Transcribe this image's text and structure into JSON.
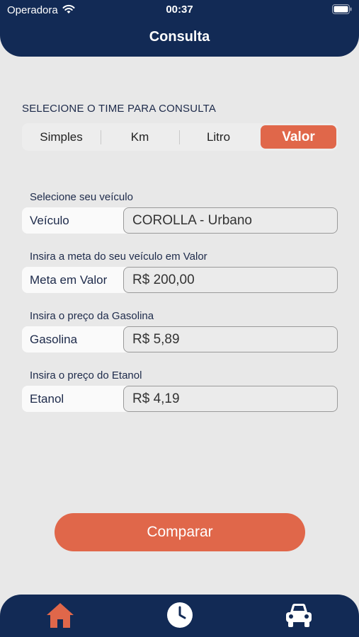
{
  "status_bar": {
    "carrier": "Operadora",
    "time": "00:37"
  },
  "header": {
    "title": "Consulta"
  },
  "selector": {
    "label": "SELECIONE O TIME PARA CONSULTA",
    "options": [
      "Simples",
      "Km",
      "Litro",
      "Valor"
    ],
    "selected": "Valor"
  },
  "form": {
    "vehicle": {
      "caption": "Selecione seu veículo",
      "label": "Veículo",
      "value": "COROLLA - Urbano"
    },
    "goal": {
      "caption": "Insira a meta do seu veículo em Valor",
      "label": "Meta em Valor",
      "value": "R$ 200,00"
    },
    "gasoline": {
      "caption": "Insira o preço da Gasolina",
      "label": "Gasolina",
      "value": "R$ 5,89"
    },
    "ethanol": {
      "caption": "Insira o preço do Etanol",
      "label": "Etanol",
      "value": "R$ 4,19"
    }
  },
  "actions": {
    "compare_label": "Comparar"
  },
  "tabbar": {
    "tabs": [
      {
        "icon": "home-icon",
        "active": true
      },
      {
        "icon": "clock-icon",
        "active": false
      },
      {
        "icon": "car-icon",
        "active": false
      }
    ]
  },
  "colors": {
    "primary": "#122a55",
    "accent": "#e0674a",
    "background": "#e8e8e8"
  }
}
